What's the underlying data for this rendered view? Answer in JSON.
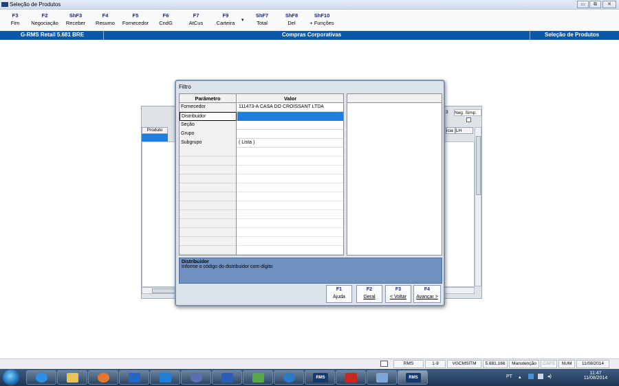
{
  "window": {
    "title": "Seleção de Produtos",
    "controls": [
      "minimize",
      "restore",
      "close"
    ]
  },
  "function_bar": [
    {
      "key": "F3",
      "label": "Fim"
    },
    {
      "key": "F2",
      "label": "Negociação"
    },
    {
      "key": "ShF3",
      "label": "Receber"
    },
    {
      "key": "F4",
      "label": "Resumo"
    },
    {
      "key": "F5",
      "label": "Fornecedor"
    },
    {
      "key": "F6",
      "label": "CndG"
    },
    {
      "key": "F7",
      "label": "AtCus"
    },
    {
      "key": "F9",
      "label": "Carteira"
    },
    {
      "key": "ShF7",
      "label": "Total"
    },
    {
      "key": "ShF8",
      "label": "Del"
    },
    {
      "key": "ShF10",
      "label": "+ Funções"
    }
  ],
  "header": {
    "left": "G-RMS Retail 5.681 BRE",
    "center": "Compras Corporativas",
    "right": "Seleção de Produtos"
  },
  "background_window": {
    "column_produto": "Produto",
    "col_3": "3",
    "col_neg_simp": "Neg. Simp.",
    "col_icia": "icia",
    "col_lh": "LH"
  },
  "dialog": {
    "title": "Filtro",
    "columns": {
      "parametro": "Parâmetro",
      "valor": "Valor"
    },
    "rows": [
      {
        "param": "Fornecedor",
        "value": "111473-A CASA DO CROISSANT LTDA"
      },
      {
        "param": "Distribuidor",
        "value": ""
      },
      {
        "param": "Seção",
        "value": ""
      },
      {
        "param": "Grupo",
        "value": ""
      },
      {
        "param": "Subgrupo",
        "value": "( Lista )"
      }
    ],
    "selected_row": "Distribuidor",
    "help": {
      "title": "Distribuidor",
      "text": "Informe o código do distribuidor com dígito"
    },
    "buttons": [
      {
        "key": "F1",
        "label": "Ajuda"
      },
      {
        "key": "F2",
        "label": "Geral"
      },
      {
        "key": "F3",
        "label": "< Voltar"
      },
      {
        "key": "F4",
        "label": "Avançar >"
      }
    ]
  },
  "status_bar": [
    "RMS",
    "1-9",
    "VGCMSITM",
    "5.681.166",
    "Manutenção",
    "CAPS",
    "NUM",
    "11/08/2014"
  ],
  "taskbar": {
    "apps": [
      "internet-explorer",
      "file-explorer",
      "media-player",
      "outlook",
      "lync",
      "meeting",
      "word",
      "calculator",
      "remote",
      "rms",
      "acrobat",
      "app",
      "rms"
    ],
    "app_texts": {
      "rms": "RMS"
    },
    "tray": {
      "lang": "PT",
      "time": "11:47",
      "date": "11/08/2014"
    }
  },
  "colors": {
    "accent_blue": "#0c58a8",
    "selection": "#1e7fe0",
    "help_bg": "#6f8fbf"
  }
}
